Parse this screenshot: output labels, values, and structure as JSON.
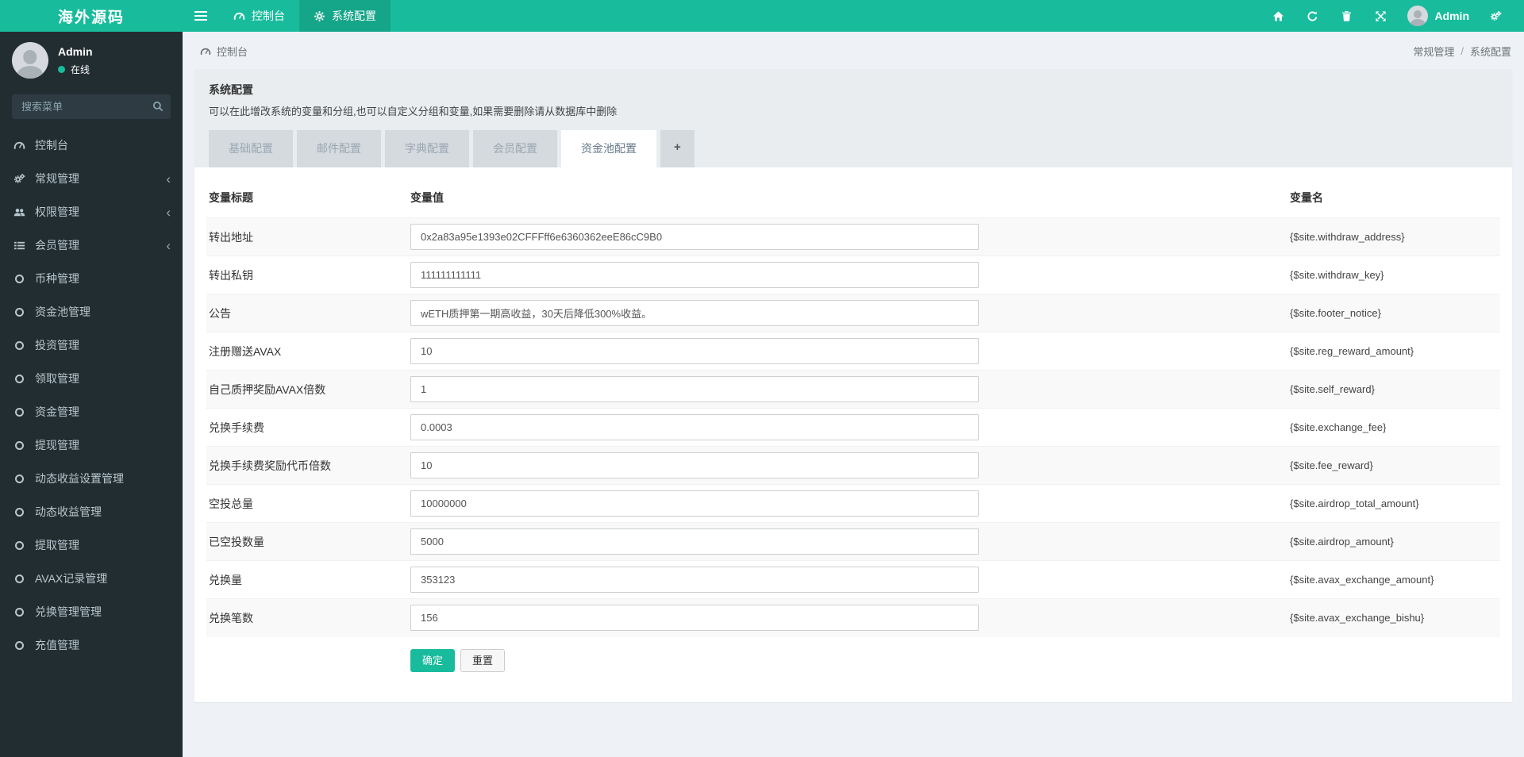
{
  "colors": {
    "accent_teal": "#18bc9c",
    "navbar_active": "#15a589",
    "sidebar_bg": "#222d32",
    "online_dot": "#18bc9c"
  },
  "navbar": {
    "logo": "海外源码",
    "menu": [
      {
        "icon": "dashboard-icon",
        "label": "控制台",
        "active": false
      },
      {
        "icon": "gear-icon",
        "label": "系统配置",
        "active": true
      }
    ],
    "right_icons": [
      "home-icon",
      "refresh-icon",
      "trash-icon",
      "expand-icon"
    ],
    "user": {
      "name": "Admin"
    },
    "settings_icon": "gears-icon"
  },
  "sidebar": {
    "user": {
      "name": "Admin",
      "status": "在线"
    },
    "search": {
      "placeholder": "搜索菜单",
      "icon": "search-icon"
    },
    "menu": [
      {
        "icon": "dashboard-icon",
        "label": "控制台",
        "expandable": false
      },
      {
        "icon": "gears-icon",
        "label": "常规管理",
        "expandable": true
      },
      {
        "icon": "users-icon",
        "label": "权限管理",
        "expandable": true
      },
      {
        "icon": "list-icon",
        "label": "会员管理",
        "expandable": true
      },
      {
        "icon": "circle-icon",
        "label": "币种管理",
        "expandable": false
      },
      {
        "icon": "circle-icon",
        "label": "资金池管理",
        "expandable": false
      },
      {
        "icon": "circle-icon",
        "label": "投资管理",
        "expandable": false
      },
      {
        "icon": "circle-icon",
        "label": "领取管理",
        "expandable": false
      },
      {
        "icon": "circle-icon",
        "label": "资金管理",
        "expandable": false
      },
      {
        "icon": "circle-icon",
        "label": "提现管理",
        "expandable": false
      },
      {
        "icon": "circle-icon",
        "label": "动态收益设置管理",
        "expandable": false
      },
      {
        "icon": "circle-icon",
        "label": "动态收益管理",
        "expandable": false
      },
      {
        "icon": "circle-icon",
        "label": "提取管理",
        "expandable": false
      },
      {
        "icon": "circle-icon",
        "label": "AVAX记录管理",
        "expandable": false
      },
      {
        "icon": "circle-icon",
        "label": "兑换管理管理",
        "expandable": false
      },
      {
        "icon": "circle-icon",
        "label": "充值管理",
        "expandable": false
      }
    ],
    "chevron": "‹"
  },
  "breadcrumb": {
    "left": "控制台",
    "right": {
      "parent": "常规管理",
      "separator": "/",
      "current": "系统配置"
    }
  },
  "panel": {
    "title": "系统配置",
    "description": "可以在此增改系统的变量和分组,也可以自定义分组和变量,如果需要删除请从数据库中删除",
    "tabs": [
      {
        "label": "基础配置",
        "active": false
      },
      {
        "label": "邮件配置",
        "active": false
      },
      {
        "label": "字典配置",
        "active": false
      },
      {
        "label": "会员配置",
        "active": false
      },
      {
        "label": "资金池配置",
        "active": true
      }
    ],
    "add_tab_label": "+",
    "table": {
      "headers": [
        "变量标题",
        "变量值",
        "变量名"
      ],
      "rows": [
        {
          "title": "转出地址",
          "value": "0x2a83a95e1393e02CFFFff6e6360362eeE86cC9B0",
          "name": "{$site.withdraw_address}"
        },
        {
          "title": "转出私钥",
          "value": "111111111111",
          "name": "{$site.withdraw_key}"
        },
        {
          "title": "公告",
          "value": "wETH质押第一期高收益，30天后降低300%收益。",
          "name": "{$site.footer_notice}"
        },
        {
          "title": "注册赠送AVAX",
          "value": "10",
          "name": "{$site.reg_reward_amount}"
        },
        {
          "title": "自己质押奖励AVAX倍数",
          "value": "1",
          "name": "{$site.self_reward}"
        },
        {
          "title": "兑换手续费",
          "value": "0.0003",
          "name": "{$site.exchange_fee}"
        },
        {
          "title": "兑换手续费奖励代币倍数",
          "value": "10",
          "name": "{$site.fee_reward}"
        },
        {
          "title": "空投总量",
          "value": "10000000",
          "name": "{$site.airdrop_total_amount}"
        },
        {
          "title": "已空投数量",
          "value": "5000",
          "name": "{$site.airdrop_amount}"
        },
        {
          "title": "兑换量",
          "value": "353123",
          "name": "{$site.avax_exchange_amount}"
        },
        {
          "title": "兑换笔数",
          "value": "156",
          "name": "{$site.avax_exchange_bishu}"
        }
      ]
    },
    "buttons": {
      "ok": "确定",
      "reset": "重置"
    }
  }
}
